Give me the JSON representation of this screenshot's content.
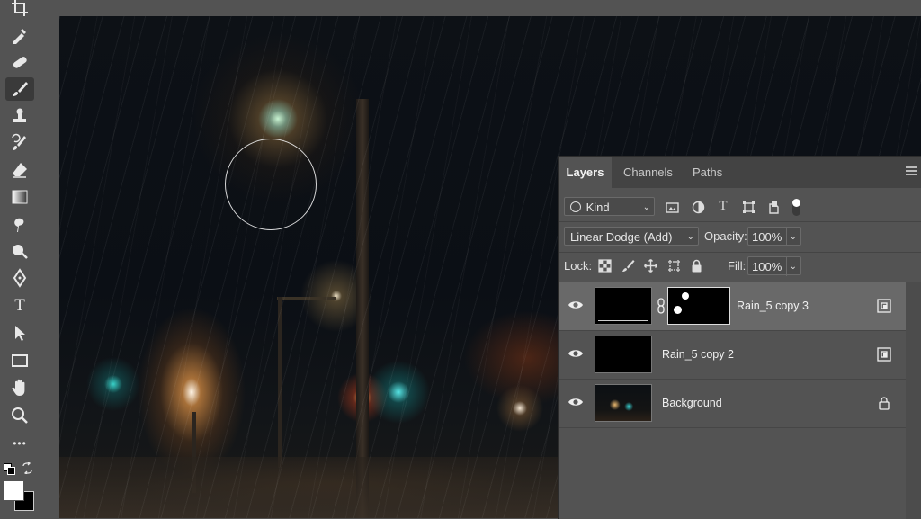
{
  "toolbar": {
    "tools": [
      {
        "name": "crop-tool-icon",
        "active": false
      },
      {
        "name": "eyedropper-tool-icon",
        "active": false
      },
      {
        "name": "healing-brush-tool-icon",
        "active": false
      },
      {
        "name": "brush-tool-icon",
        "active": true
      },
      {
        "name": "clone-stamp-tool-icon",
        "active": false
      },
      {
        "name": "history-brush-tool-icon",
        "active": false
      },
      {
        "name": "eraser-tool-icon",
        "active": false
      },
      {
        "name": "gradient-tool-icon",
        "active": false
      },
      {
        "name": "smudge-tool-icon",
        "active": false
      },
      {
        "name": "dodge-tool-icon",
        "active": false
      },
      {
        "name": "pen-tool-icon",
        "active": false
      },
      {
        "name": "type-tool-icon",
        "active": false,
        "glyph": "T"
      },
      {
        "name": "path-selection-tool-icon",
        "active": false
      },
      {
        "name": "rectangle-tool-icon",
        "active": false
      },
      {
        "name": "hand-tool-icon",
        "active": false
      },
      {
        "name": "zoom-tool-icon",
        "active": false
      },
      {
        "name": "more-tools-icon",
        "active": false,
        "glyph": "•••"
      }
    ],
    "foreground_color": "#ffffff",
    "background_color": "#000000"
  },
  "layers_panel": {
    "tabs": [
      "Layers",
      "Channels",
      "Paths"
    ],
    "active_tab": "Layers",
    "filter": {
      "label": "Kind"
    },
    "blend_mode": "Linear Dodge (Add)",
    "opacity_label": "Opacity:",
    "opacity_value": "100%",
    "lock_label": "Lock:",
    "fill_label": "Fill:",
    "fill_value": "100%",
    "layers": [
      {
        "name": "Rain_5 copy 3",
        "visible": true,
        "selected": true,
        "has_mask": true,
        "locked": false
      },
      {
        "name": "Rain_5 copy 2",
        "visible": true,
        "selected": false,
        "has_mask": false,
        "locked": false
      },
      {
        "name": "Background",
        "visible": true,
        "selected": false,
        "has_mask": false,
        "locked": true
      }
    ]
  },
  "colors": {
    "ui_background": "#535353",
    "panel_tab_bar": "#434343",
    "selected_layer": "#696969"
  }
}
